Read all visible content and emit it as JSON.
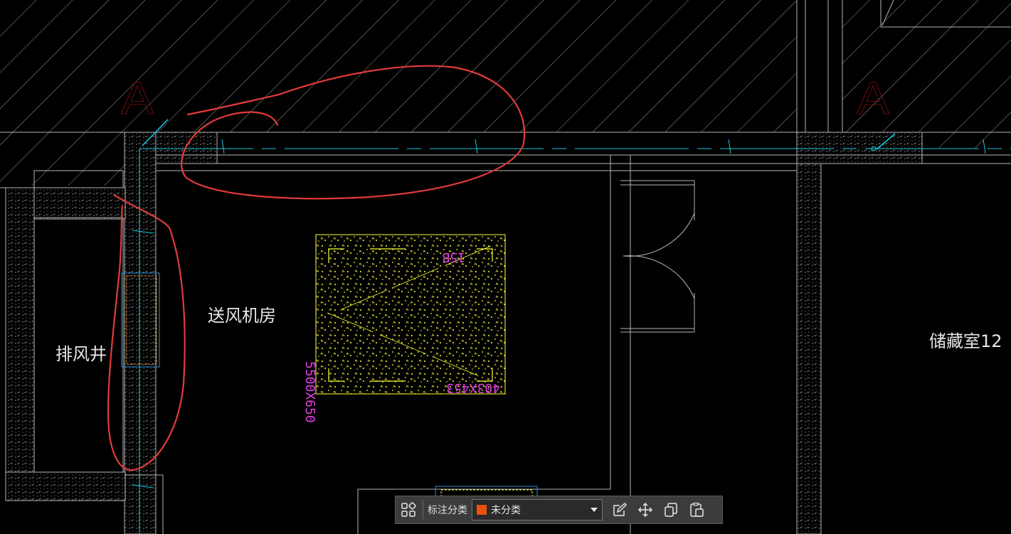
{
  "drawing": {
    "axis_labels": [
      "A",
      "A"
    ],
    "rooms": {
      "exhaust_shaft": "排风井",
      "supply_fan_room": "送风机房",
      "storage_room": "储藏室12"
    },
    "equipment": {
      "tag_top": "15B",
      "tag_bottom": "403X453",
      "tag_side": "5500X650"
    },
    "colors": {
      "background": "#000000",
      "wall_line": "#b4b4b4",
      "axis_text": "#c81414",
      "cyan_line": "#18c8e0",
      "equipment_yellow": "#ffff33",
      "magenta_text": "#e040e0",
      "annotation_red": "#e23b3b",
      "blue_box": "#2e8fe0"
    }
  },
  "toolbar": {
    "layout_icon": "four-squares-icon",
    "category_label": "标注分类",
    "category_value": "未分类",
    "category_color": "#e8500f",
    "edit_icon": "edit-icon",
    "move_icon": "move-icon",
    "copy_icon": "copy-icon",
    "paste_icon": "paste-icon"
  }
}
